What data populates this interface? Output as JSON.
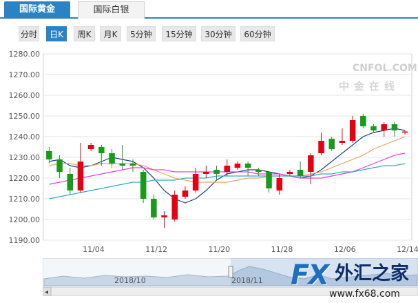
{
  "tabs": [
    {
      "label": "国际黄金",
      "active": true
    },
    {
      "label": "国际白银",
      "active": false
    }
  ],
  "periods": [
    {
      "label": "分时",
      "active": false
    },
    {
      "label": "日K",
      "active": true
    },
    {
      "label": "周K",
      "active": false
    },
    {
      "label": "月K",
      "active": false
    },
    {
      "label": "5分钟",
      "active": false
    },
    {
      "label": "15分钟",
      "active": false
    },
    {
      "label": "30分钟",
      "active": false
    },
    {
      "label": "60分钟",
      "active": false
    }
  ],
  "watermark": {
    "brand": "CNFOL.COM",
    "sub": "中金在线"
  },
  "logo": {
    "fx": "FX",
    "cn": "外汇之家",
    "url": "www.fx68.com"
  },
  "navigator": {
    "labels": [
      "2018/10",
      "2018/11"
    ],
    "left_arrow": "◂"
  },
  "colors": {
    "accent": "#2c83c4",
    "up": "#e60012",
    "down": "#1a9a1a",
    "ma5": "#1a3f8a",
    "ma10": "#f0a060",
    "ma20": "#e040e0",
    "ma30": "#30a8c8"
  },
  "chart_data": {
    "type": "candlestick",
    "ylim": [
      1190,
      1280
    ],
    "yticks": [
      "1280.00",
      "1270.00",
      "1260.00",
      "1250.00",
      "1240.00",
      "1230.00",
      "1220.00",
      "1210.00",
      "1200.00",
      "1190.00"
    ],
    "xtick_labels": [
      {
        "label": "11/04",
        "index": 4
      },
      {
        "label": "11/12",
        "index": 10
      },
      {
        "label": "11/20",
        "index": 16
      },
      {
        "label": "11/28",
        "index": 22
      },
      {
        "label": "12/06",
        "index": 28
      },
      {
        "label": "12/14",
        "index": 34
      }
    ],
    "candles": [
      {
        "o": 1233,
        "c": 1229,
        "h": 1235,
        "l": 1227
      },
      {
        "o": 1229,
        "c": 1223,
        "h": 1231,
        "l": 1220
      },
      {
        "o": 1222,
        "c": 1214,
        "h": 1225,
        "l": 1212
      },
      {
        "o": 1214,
        "c": 1228,
        "h": 1237,
        "l": 1213
      },
      {
        "o": 1234,
        "c": 1236,
        "h": 1237,
        "l": 1233
      },
      {
        "o": 1235,
        "c": 1232,
        "h": 1236,
        "l": 1226
      },
      {
        "o": 1232,
        "c": 1227,
        "h": 1234,
        "l": 1225
      },
      {
        "o": 1227,
        "c": 1226,
        "h": 1236,
        "l": 1224
      },
      {
        "o": 1227,
        "c": 1226,
        "h": 1229,
        "l": 1223
      },
      {
        "o": 1223,
        "c": 1210,
        "h": 1224,
        "l": 1208
      },
      {
        "o": 1210,
        "c": 1201,
        "h": 1212,
        "l": 1200
      },
      {
        "o": 1201,
        "c": 1202,
        "h": 1204,
        "l": 1196
      },
      {
        "o": 1200,
        "c": 1212,
        "h": 1214,
        "l": 1199
      },
      {
        "o": 1211,
        "c": 1214,
        "h": 1216,
        "l": 1210
      },
      {
        "o": 1214,
        "c": 1222,
        "h": 1225,
        "l": 1213
      },
      {
        "o": 1222,
        "c": 1223,
        "h": 1226,
        "l": 1220
      },
      {
        "o": 1224,
        "c": 1222,
        "h": 1226,
        "l": 1219
      },
      {
        "o": 1223,
        "c": 1226,
        "h": 1229,
        "l": 1221
      },
      {
        "o": 1225,
        "c": 1227,
        "h": 1228,
        "l": 1224
      },
      {
        "o": 1227,
        "c": 1225,
        "h": 1228,
        "l": 1221
      },
      {
        "o": 1224,
        "c": 1223,
        "h": 1225,
        "l": 1221
      },
      {
        "o": 1223,
        "c": 1215,
        "h": 1223,
        "l": 1213
      },
      {
        "o": 1214,
        "c": 1220,
        "h": 1222,
        "l": 1212
      },
      {
        "o": 1222,
        "c": 1223,
        "h": 1224,
        "l": 1221
      },
      {
        "o": 1224,
        "c": 1221,
        "h": 1228,
        "l": 1220
      },
      {
        "o": 1223,
        "c": 1231,
        "h": 1232,
        "l": 1217
      },
      {
        "o": 1232,
        "c": 1238,
        "h": 1242,
        "l": 1231
      },
      {
        "o": 1239,
        "c": 1234,
        "h": 1240,
        "l": 1233
      },
      {
        "o": 1237,
        "c": 1238,
        "h": 1244,
        "l": 1236
      },
      {
        "o": 1238,
        "c": 1248,
        "h": 1250,
        "l": 1237
      },
      {
        "o": 1250,
        "c": 1245,
        "h": 1251,
        "l": 1244
      },
      {
        "o": 1245,
        "c": 1243,
        "h": 1246,
        "l": 1242
      },
      {
        "o": 1243,
        "c": 1246,
        "h": 1247,
        "l": 1240
      },
      {
        "o": 1246,
        "c": 1243,
        "h": 1247,
        "l": 1240
      },
      {
        "o": 1242,
        "c": 1242.5,
        "h": 1243,
        "l": 1241
      }
    ],
    "ma_lines": [
      {
        "key": "ma5",
        "values": [
          1228,
          1229,
          1226,
          1225,
          1226,
          1228,
          1230,
          1229,
          1228,
          1225,
          1220,
          1214,
          1210,
          1208,
          1210,
          1214,
          1219,
          1222,
          1223,
          1224,
          1224,
          1223,
          1222,
          1221,
          1220,
          1221,
          1224,
          1228,
          1232,
          1236,
          1240,
          1242,
          1243,
          1244,
          1243
        ]
      },
      {
        "key": "ma10",
        "values": [
          1226,
          1227,
          1227,
          1226,
          1226,
          1227,
          1227,
          1227,
          1227,
          1226,
          1224,
          1222,
          1220,
          1219,
          1218,
          1218,
          1218,
          1218,
          1219,
          1220,
          1220,
          1221,
          1221,
          1221,
          1221,
          1222,
          1223,
          1225,
          1227,
          1229,
          1231,
          1234,
          1236,
          1238,
          1240
        ]
      },
      {
        "key": "ma20",
        "values": [
          1217,
          1218,
          1219,
          1220,
          1221,
          1222,
          1223,
          1224,
          1225,
          1225,
          1224,
          1224,
          1223,
          1223,
          1223,
          1223,
          1223,
          1223,
          1223,
          1223,
          1222,
          1222,
          1222,
          1221,
          1220,
          1220,
          1220,
          1221,
          1222,
          1223,
          1225,
          1227,
          1229,
          1231,
          1232
        ]
      },
      {
        "key": "ma30",
        "values": [
          1210,
          1211,
          1212,
          1213,
          1214,
          1215,
          1216,
          1217,
          1218,
          1218,
          1219,
          1219,
          1219,
          1220,
          1220,
          1220,
          1221,
          1221,
          1221,
          1221,
          1221,
          1221,
          1221,
          1221,
          1221,
          1221,
          1222,
          1222,
          1223,
          1223,
          1224,
          1225,
          1226,
          1226,
          1227
        ]
      }
    ]
  }
}
